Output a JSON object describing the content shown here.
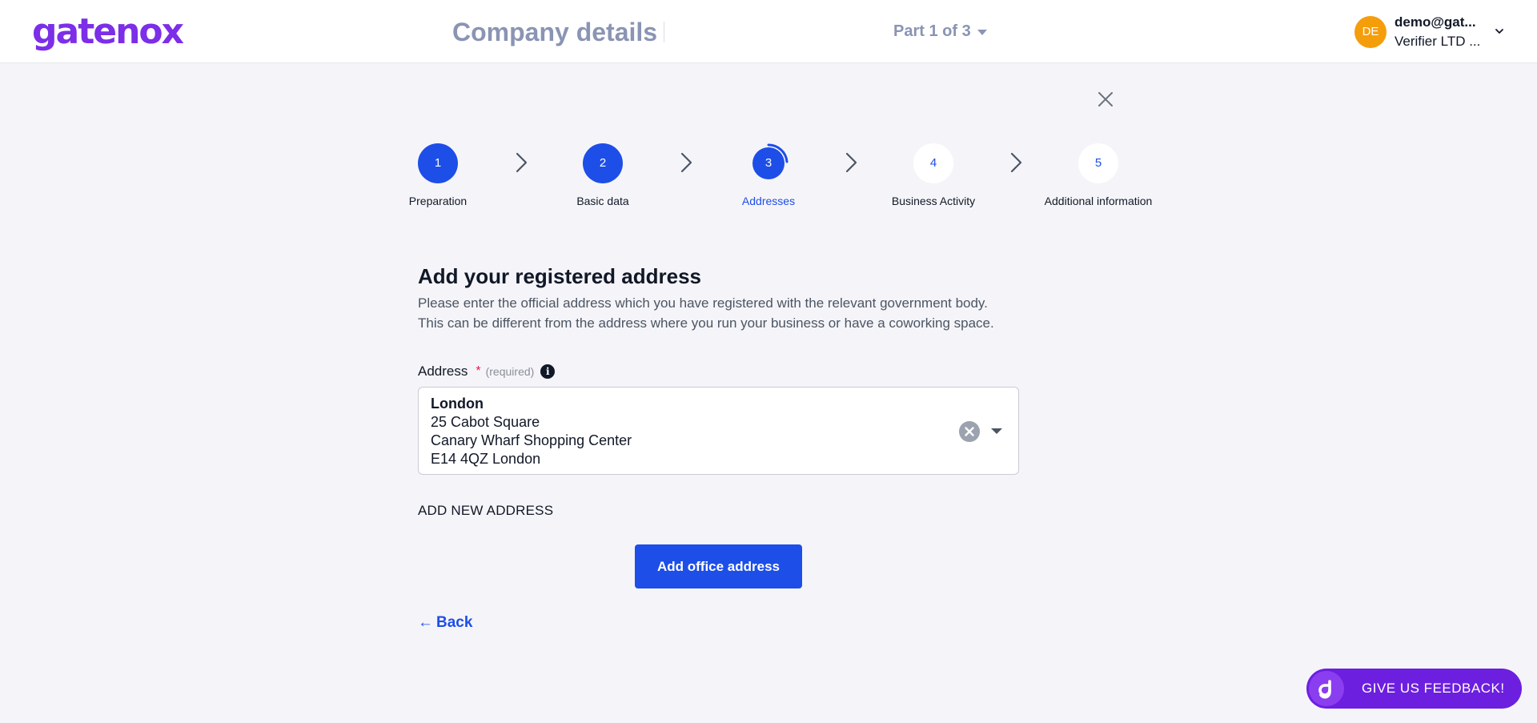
{
  "header": {
    "logo": "gatenox",
    "title": "Company details",
    "part_label": "Part 1 of 3",
    "user": {
      "initials": "DE",
      "email": "demo@gat...",
      "org": "Verifier LTD ..."
    }
  },
  "stepper": {
    "steps": [
      {
        "number": "1",
        "label": "Preparation",
        "state": "done"
      },
      {
        "number": "2",
        "label": "Basic data",
        "state": "done"
      },
      {
        "number": "3",
        "label": "Addresses",
        "state": "active"
      },
      {
        "number": "4",
        "label": "Business Activity",
        "state": "todo"
      },
      {
        "number": "5",
        "label": "Additional information",
        "state": "todo"
      }
    ]
  },
  "main": {
    "title": "Add your registered address",
    "description_line1": "Please enter the official address which you have registered with the relevant government body.",
    "description_line2": "This can be different from the address where you run your business or have a coworking space.",
    "address_field": {
      "label": "Address",
      "required_star": "*",
      "required_text": "(required)",
      "info_glyph": "i",
      "value": {
        "city": "London",
        "line1": "25 Cabot Square",
        "line2": "Canary Wharf Shopping Center",
        "line3": "E14 4QZ London"
      }
    },
    "add_new_address_label": "ADD NEW ADDRESS",
    "add_office_button": "Add office address",
    "back_arrow": "←",
    "back_label": "Back"
  },
  "feedback": {
    "label": "GIVE US FEEDBACK!"
  },
  "colors": {
    "primary": "#1d4ee8",
    "brand": "#7c2ee8",
    "feedback": "#6d1fe0",
    "avatar": "#f59e0b"
  }
}
